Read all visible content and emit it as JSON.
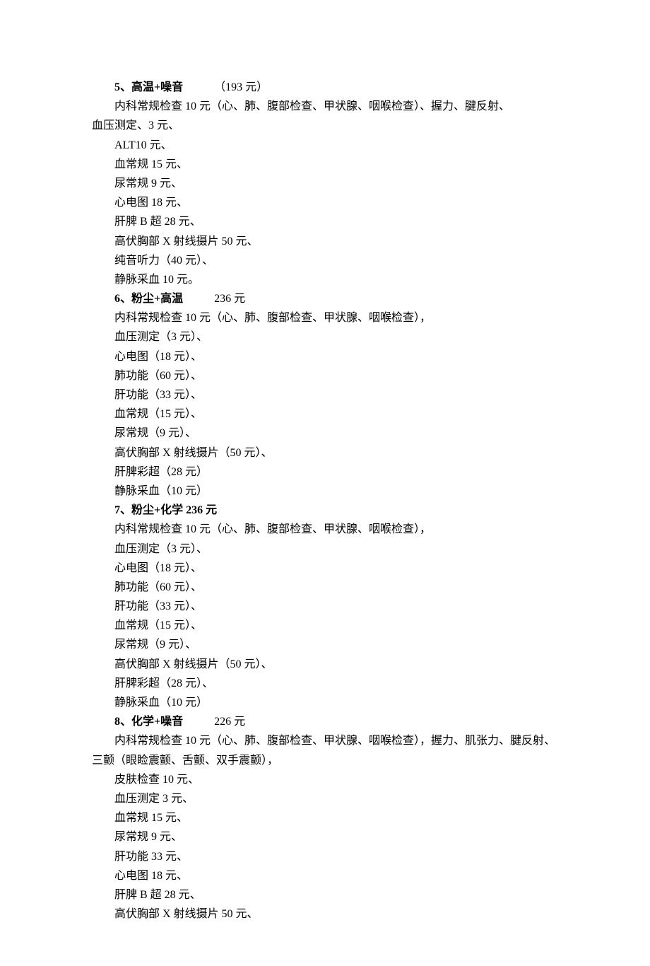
{
  "sections": {
    "5": {
      "number": "5、高温+噪音",
      "price": "（193 元）",
      "lines": [
        "内科常规检查 10 元（心、肺、腹部检查、甲状腺、咽喉检查）、握力、腱反射、",
        "血压测定、3 元、",
        "ALT10 元、",
        "血常规 15 元、",
        "尿常规 9 元、",
        "心电图 18 元、",
        "肝脾 B 超 28 元、",
        "高伏胸部 X 射线摄片 50 元、",
        "纯音听力（40 元）、",
        "静脉采血 10 元。"
      ]
    },
    "6": {
      "number": "6、粉尘+高温",
      "price": "236 元",
      "lines": [
        "内科常规检查 10 元（心、肺、腹部检查、甲状腺、咽喉检查），",
        "血压测定（3 元）、",
        "心电图（18 元）、",
        "肺功能（60 元）、",
        "肝功能（33 元）、",
        "血常规（15 元）、",
        "尿常规（9 元）、",
        "高伏胸部 X 射线摄片（50 元）、",
        "肝脾彩超（28 元）",
        "静脉采血（10 元）"
      ]
    },
    "7": {
      "number": "7、粉尘+化学 236 元",
      "price": "",
      "lines": [
        "内科常规检查 10 元（心、肺、腹部检查、甲状腺、咽喉检查），",
        "血压测定（3 元）、",
        "心电图（18 元）、",
        "肺功能（60 元）、",
        "肝功能（33 元）、",
        "血常规（15 元）、",
        "尿常规（9 元）、",
        "高伏胸部 X 射线摄片（50 元）、",
        "肝脾彩超（28 元）、",
        "静脉采血（10 元）"
      ]
    },
    "8": {
      "number": "8、化学+噪音",
      "price": "226 元",
      "line1": "内科常规检查 10 元（心、肺、腹部检查、甲状腺、咽喉检查），握力、肌张力、腱反射、",
      "line2": "三颤（眼睑震颤、舌颤、双手震颤），",
      "lines": [
        "皮肤检查 10 元、",
        "血压测定 3 元、",
        "血常规 15 元、",
        "尿常规 9 元、",
        "肝功能 33 元、",
        "心电图 18 元、",
        "肝脾 B 超 28 元、",
        "高伏胸部 X 射线摄片 50 元、"
      ]
    }
  }
}
